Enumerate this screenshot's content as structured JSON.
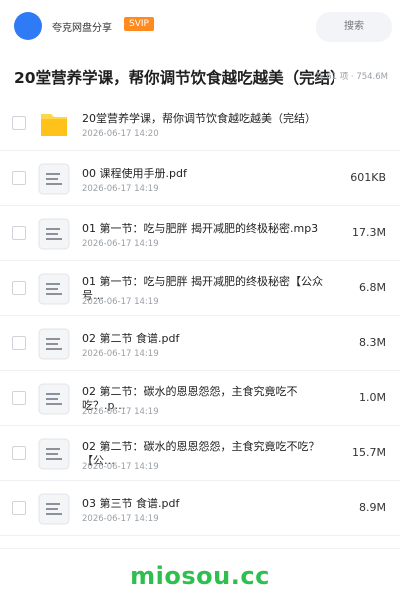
{
  "header": {
    "brand": "夸克网盘分享",
    "badge": "SVIP",
    "search_placeholder": "搜索",
    "colors": {
      "logo": "#2f7bf5",
      "badge": "#ff8a1f"
    }
  },
  "folder": {
    "title": "20堂营养学课，帮你调节饮食越吃越美（完结）",
    "meta": "共 61 项 · 754.6M"
  },
  "files": [
    {
      "icon": "folder-icon",
      "name": "20堂营养学课，帮你调节饮食越吃越美（完结）",
      "date": "2026-06-17 14:20",
      "size": ""
    },
    {
      "icon": "document-icon",
      "name": "00 课程使用手册.pdf",
      "date": "2026-06-17 14:19",
      "size": "601KB"
    },
    {
      "icon": "document-icon",
      "name": "01 第一节：吃与肥胖 揭开减肥的终极秘密.mp3",
      "date": "2026-06-17 14:19",
      "size": "17.3M"
    },
    {
      "icon": "document-icon",
      "name": "01 第一节：吃与肥胖 揭开减肥的终极秘密【公众号…",
      "date": "2026-06-17 14:19",
      "size": "6.8M"
    },
    {
      "icon": "document-icon",
      "name": "02 第二节 食谱.pdf",
      "date": "2026-06-17 14:19",
      "size": "8.3M"
    },
    {
      "icon": "document-icon",
      "name": "02 第二节：碳水的恩恩怨怨，主食究竟吃不吃？.p…",
      "date": "2026-06-17 14:19",
      "size": "1.0M"
    },
    {
      "icon": "document-icon",
      "name": "02 第二节：碳水的恩恩怨怨，主食究竟吃不吃？【公…",
      "date": "2026-06-17 14:19",
      "size": "15.7M"
    },
    {
      "icon": "document-icon",
      "name": "03 第三节 食谱.pdf",
      "date": "2026-06-17 14:19",
      "size": "8.9M"
    }
  ],
  "watermark": "miosou.cc",
  "colors": {
    "watermark": "#2fbf4f",
    "folder": "#ffc21a"
  }
}
